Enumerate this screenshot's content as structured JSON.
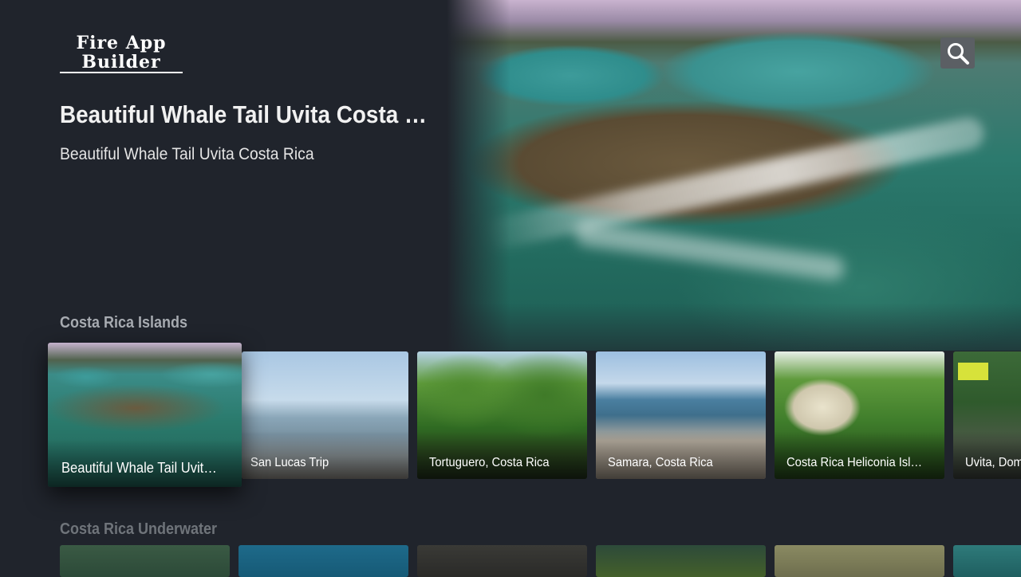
{
  "app": {
    "logo_line1": "Fire App",
    "logo_line2": "Builder"
  },
  "header": {
    "search_icon": "search-icon"
  },
  "featured": {
    "title": "Beautiful Whale Tail Uvita Costa Rica",
    "subtitle": "Beautiful Whale Tail Uvita Costa Rica"
  },
  "rows": [
    {
      "title": "Costa Rica Islands",
      "cards": [
        {
          "label": "Beautiful Whale Tail Uvita Costa Rica",
          "focused": true
        },
        {
          "label": "San Lucas Trip"
        },
        {
          "label": "Tortuguero, Costa Rica"
        },
        {
          "label": "Samara, Costa Rica"
        },
        {
          "label": "Costa Rica Heliconia Island"
        },
        {
          "label": "Uvita, Dominical"
        }
      ]
    },
    {
      "title": "Costa Rica Underwater",
      "cards": []
    }
  ],
  "colors": {
    "background": "#20242c",
    "search_button": "#5b5f64",
    "row_header_focused": "#a7abb1",
    "row_header_dim": "#6f747a"
  }
}
